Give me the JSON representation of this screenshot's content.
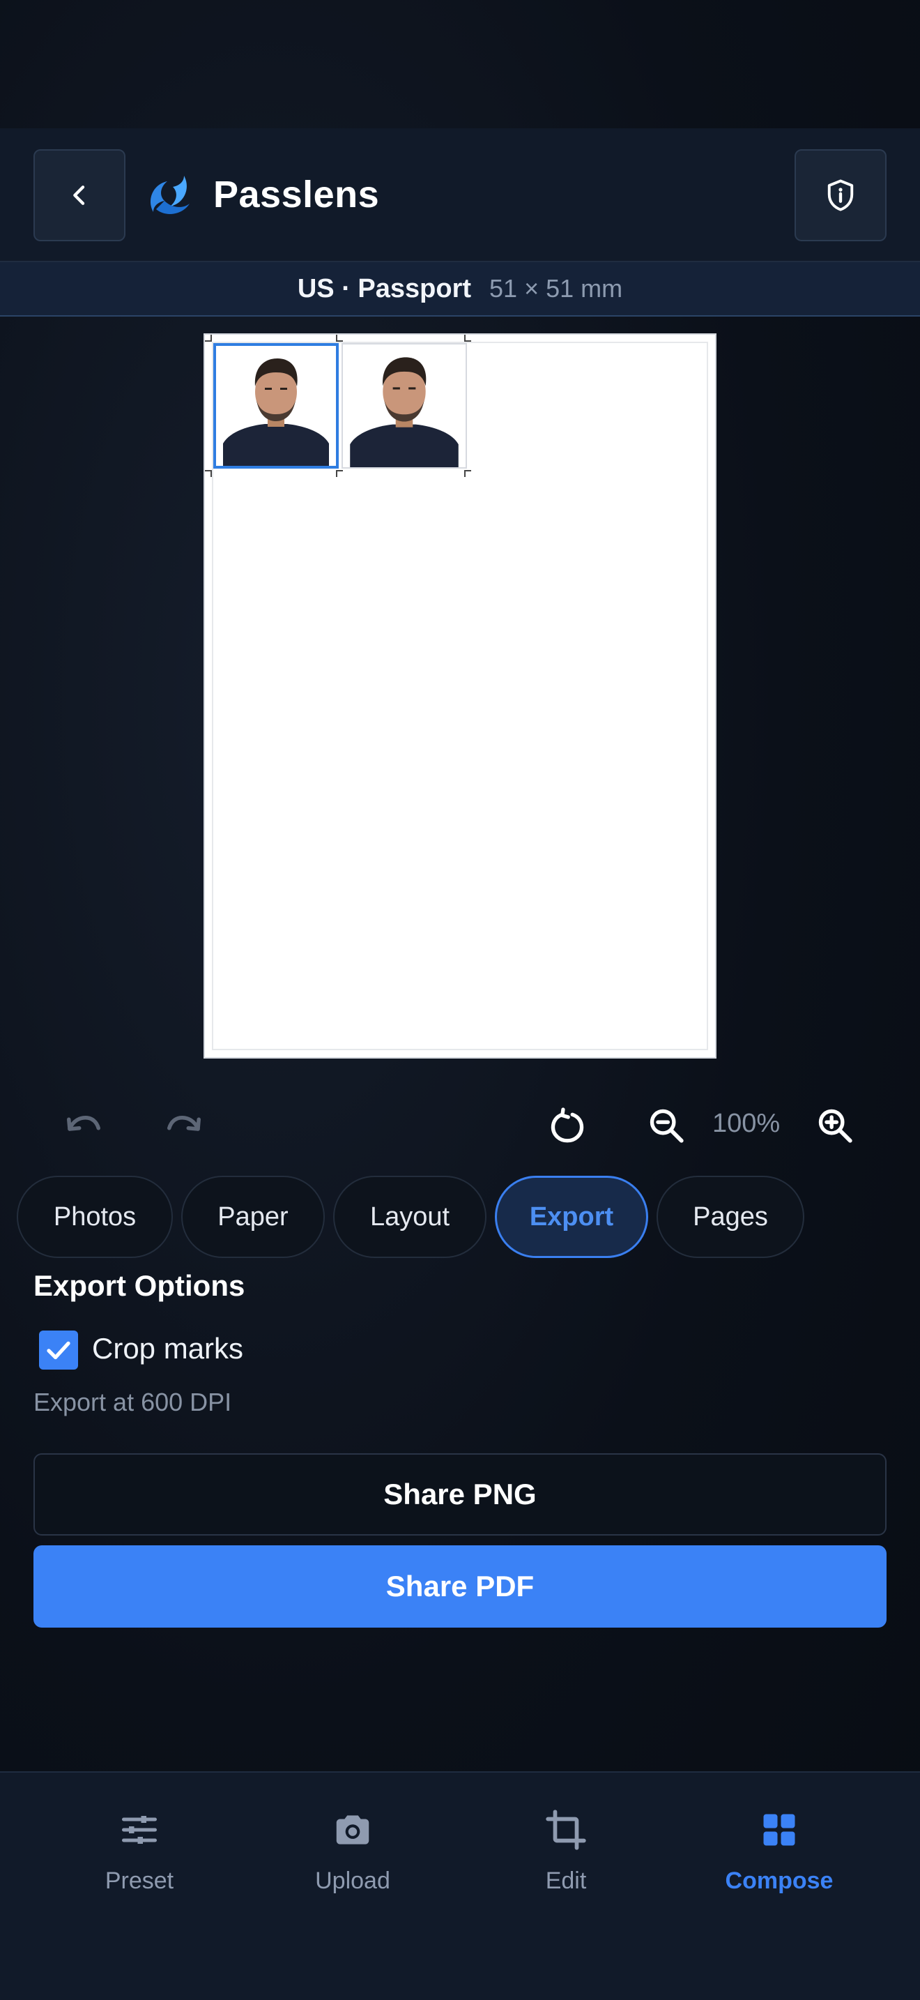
{
  "header": {
    "app_title": "Passlens",
    "back_icon": "chevron-left-icon",
    "info_icon": "shield-info-icon"
  },
  "document": {
    "type": "US · Passport",
    "size": "51 × 51 mm"
  },
  "canvas": {
    "photo_count": 2,
    "selected_photo": 1
  },
  "toolbar": {
    "zoom": "100%",
    "icons": [
      "undo-icon",
      "redo-icon",
      "rotate-icon",
      "zoom-out-icon",
      "zoom-in-icon"
    ]
  },
  "tabs": [
    {
      "label": "Photos",
      "active": false
    },
    {
      "label": "Paper",
      "active": false
    },
    {
      "label": "Layout",
      "active": false
    },
    {
      "label": "Export",
      "active": true
    },
    {
      "label": "Pages",
      "active": false
    }
  ],
  "export": {
    "title": "Export Options",
    "crop_marks_label": "Crop marks",
    "crop_marks_checked": true,
    "dpi_text": "Export at 600 DPI",
    "share_png": "Share PNG",
    "share_pdf": "Share PDF"
  },
  "bottom_nav": [
    {
      "label": "Preset",
      "icon": "sliders-icon",
      "active": false
    },
    {
      "label": "Upload",
      "icon": "camera-icon",
      "active": false
    },
    {
      "label": "Edit",
      "icon": "crop-icon",
      "active": false
    },
    {
      "label": "Compose",
      "icon": "grid-icon",
      "active": true
    }
  ],
  "colors": {
    "accent": "#3b82f6",
    "background": "#0a0f18",
    "header": "#111a29"
  }
}
